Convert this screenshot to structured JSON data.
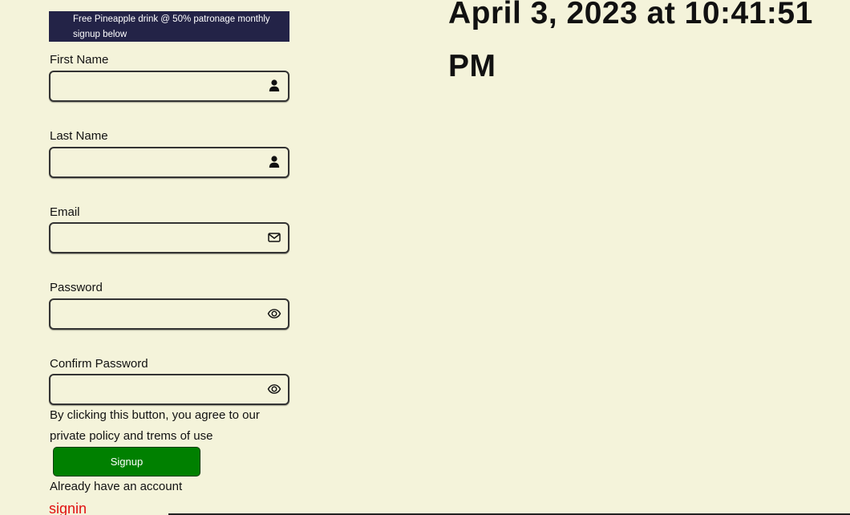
{
  "banner": {
    "text": "Free Pineapple drink @ 50% patronage monthly signup below"
  },
  "form": {
    "fields": [
      {
        "label": "First Name",
        "value": "",
        "icon": "user-icon"
      },
      {
        "label": "Last Name",
        "value": "",
        "icon": "user-icon"
      },
      {
        "label": "Email",
        "value": "",
        "icon": "envelope-icon"
      },
      {
        "label": "Password",
        "value": "",
        "icon": "eye-icon"
      },
      {
        "label": "Confirm Password",
        "value": "",
        "icon": "eye-icon"
      }
    ],
    "terms_text": "By clicking this button, you agree to our private policy and trems of use",
    "signup_label": "Signup",
    "have_account_text": "Already have an account",
    "signin_label": "signin"
  },
  "clock": {
    "datetime": "April 3, 2023 at 10:41:51 PM"
  },
  "colors": {
    "background": "#f4f3da",
    "banner": "#232347",
    "signup_button": "#008000",
    "signin_link": "#e01010"
  }
}
